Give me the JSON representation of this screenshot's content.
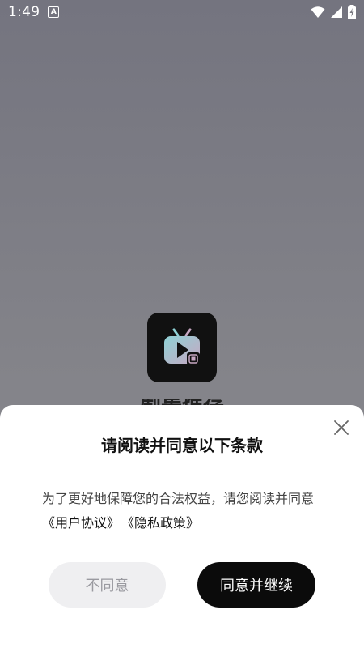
{
  "status_bar": {
    "time": "1:49",
    "notification_badge": "A",
    "icons": [
      "wifi-icon",
      "signal-icon",
      "battery-charging-icon"
    ]
  },
  "app": {
    "name": "剧集推荐"
  },
  "dialog": {
    "title": "请阅读并同意以下条款",
    "description": "为了更好地保障您的合法权益，请您阅读并同意",
    "links": [
      {
        "label": "《用户协议》"
      },
      {
        "label": "《隐私政策》"
      }
    ],
    "disagree_label": "不同意",
    "agree_label": "同意并继续"
  },
  "colors": {
    "backdrop": "#7e7e86",
    "agree_button": "#0b0b0b",
    "disagree_button": "#efeff1",
    "disagree_text": "#9a9aa0"
  }
}
